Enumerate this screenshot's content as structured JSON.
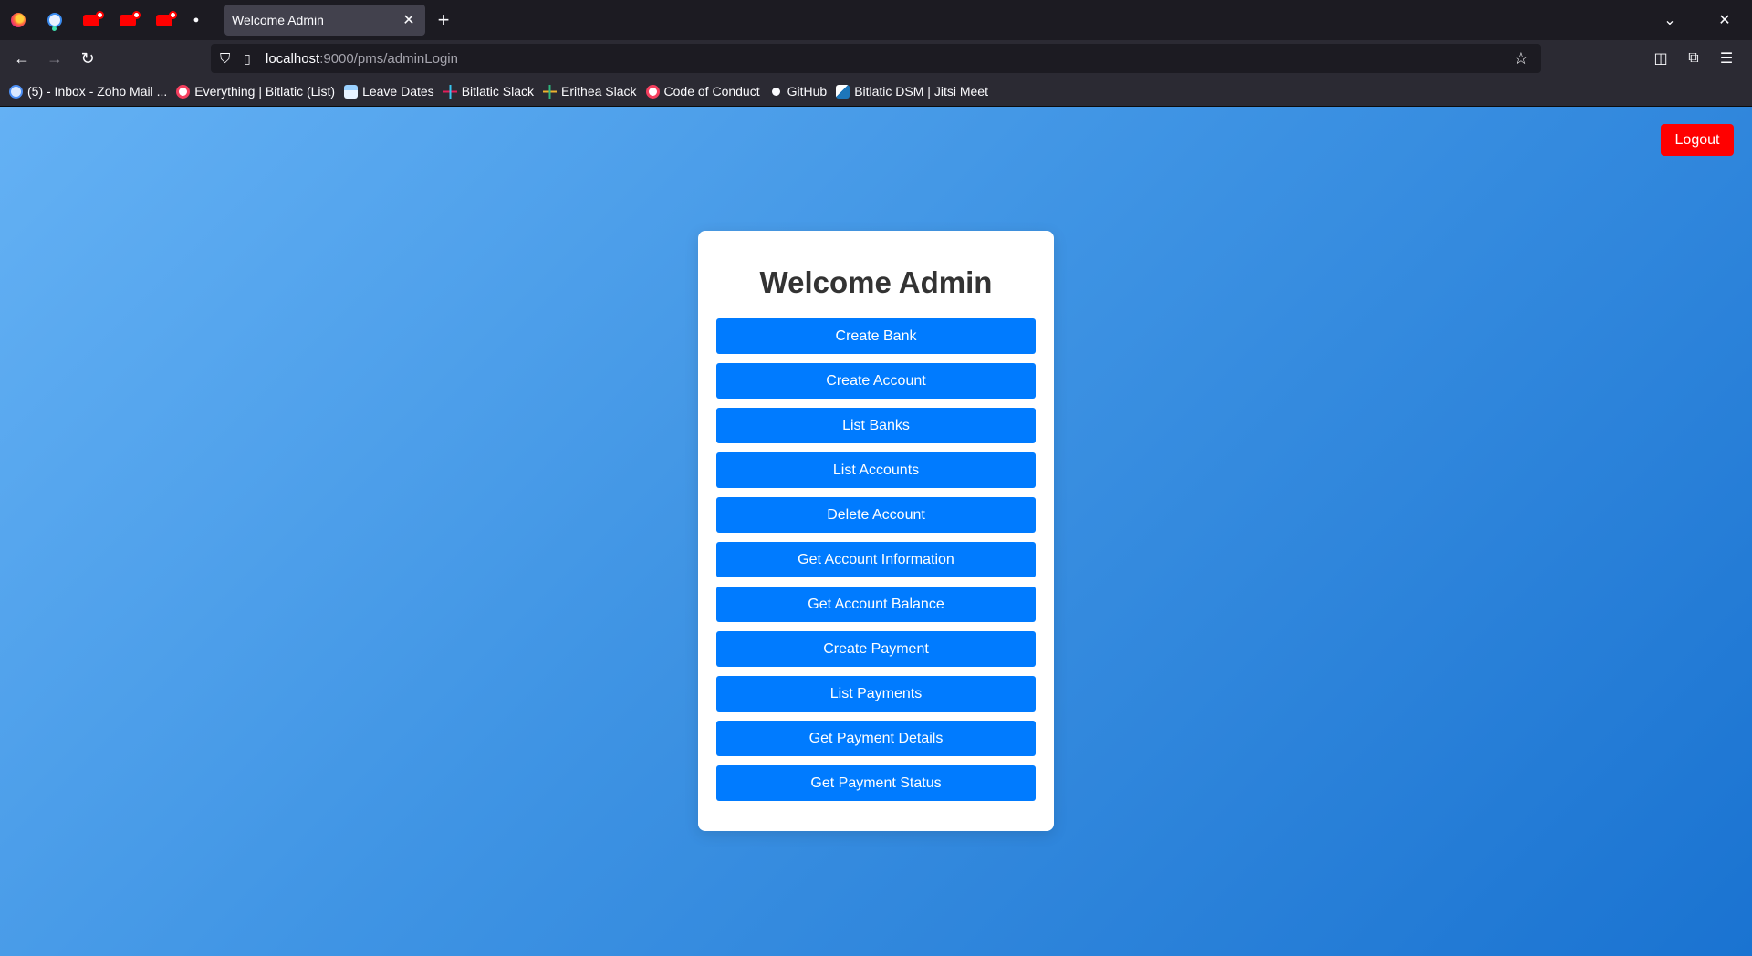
{
  "browser": {
    "tab_title": "Welcome Admin",
    "url_host": "localhost",
    "url_path": ":9000/pms/adminLogin",
    "bookmarks": [
      {
        "label": "(5) - Inbox - Zoho Mail ...",
        "icon": "zoho-mail-icon"
      },
      {
        "label": "Everything | Bitlatic (List)",
        "icon": "clickup-icon"
      },
      {
        "label": "Leave Dates",
        "icon": "calendar-icon"
      },
      {
        "label": "Bitlatic Slack",
        "icon": "slack-icon"
      },
      {
        "label": "Erithea Slack",
        "icon": "slack-icon"
      },
      {
        "label": "Code of Conduct",
        "icon": "clickup-icon"
      },
      {
        "label": "GitHub",
        "icon": "github-icon"
      },
      {
        "label": "Bitlatic DSM | Jitsi Meet",
        "icon": "jitsi-icon"
      }
    ]
  },
  "page": {
    "logout_label": "Logout",
    "title": "Welcome Admin",
    "menu": [
      "Create Bank",
      "Create Account",
      "List Banks",
      "List Accounts",
      "Delete Account",
      "Get Account Information",
      "Get Account Balance",
      "Create Payment",
      "List Payments",
      "Get Payment Details",
      "Get Payment Status"
    ]
  },
  "colors": {
    "button": "#007bff",
    "logout": "#ff0000",
    "background_start": "#64b1f4",
    "background_end": "#1a73d1"
  }
}
